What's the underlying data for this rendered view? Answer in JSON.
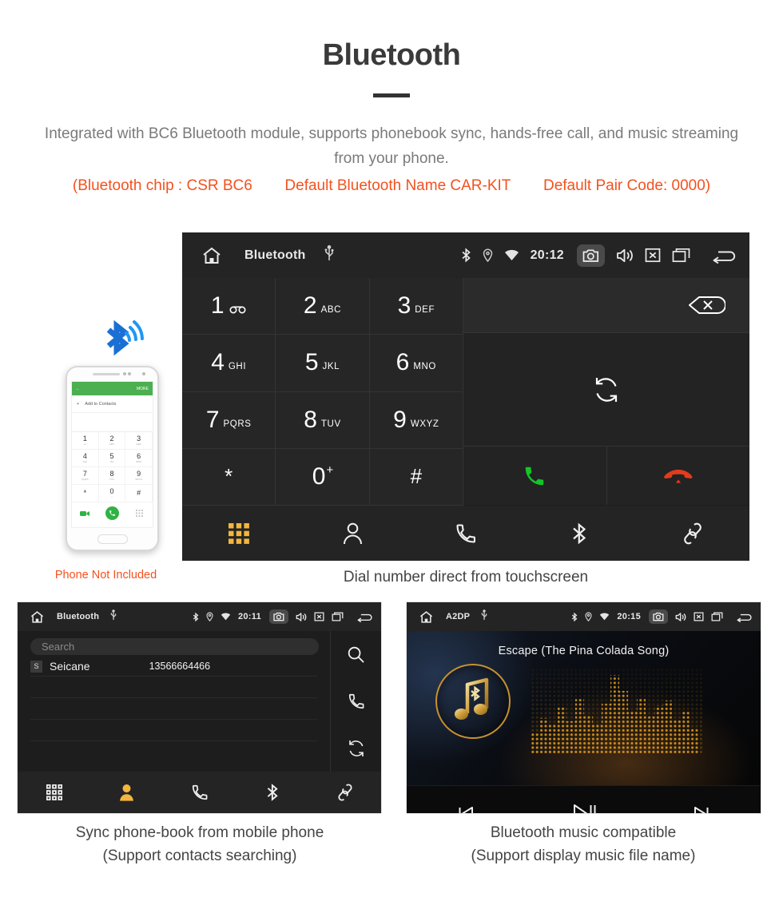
{
  "header": {
    "title": "Bluetooth",
    "intro": "Integrated with BC6 Bluetooth module, supports phonebook sync, hands-free call, and music streaming from your phone.",
    "spec_open": "(Bluetooth chip : CSR BC6",
    "spec_name": "Default Bluetooth Name CAR-KIT",
    "spec_code": "Default Pair Code: 0000)"
  },
  "accent_colors": {
    "orange_text": "#f4511e",
    "tab_active": "#f3b53f",
    "call_green": "#12c528",
    "end_red": "#e23c1d",
    "gold": "#c8912f",
    "phone_green": "#4caf50"
  },
  "main_unit": {
    "statusbar": {
      "home_icon": "home-icon",
      "title": "Bluetooth",
      "usb_icon": "usb-icon",
      "bluetooth_icon": "bluetooth-icon",
      "location_icon": "location-icon",
      "wifi_icon": "wifi-icon",
      "clock": "20:12",
      "camera_icon": "camera-icon",
      "volume_icon": "volume-icon",
      "mute_icon": "mute-box-icon",
      "windows_icon": "recent-apps-icon",
      "back_icon": "back-arrow-icon"
    },
    "keys": [
      {
        "num": "1",
        "sub": "",
        "voicemail": true
      },
      {
        "num": "2",
        "sub": "ABC"
      },
      {
        "num": "3",
        "sub": "DEF"
      },
      {
        "num": "4",
        "sub": "GHI"
      },
      {
        "num": "5",
        "sub": "JKL"
      },
      {
        "num": "6",
        "sub": "MNO"
      },
      {
        "num": "7",
        "sub": "PQRS"
      },
      {
        "num": "8",
        "sub": "TUV"
      },
      {
        "num": "9",
        "sub": "WXYZ"
      },
      {
        "num": "*",
        "sub": "",
        "symbol": true
      },
      {
        "num": "0",
        "sub": "+",
        "plus": true
      },
      {
        "num": "#",
        "sub": "",
        "symbol": true
      }
    ],
    "actions": {
      "delete_icon": "backspace-icon",
      "sync_icon": "sync-icon",
      "call_icon": "call-icon",
      "end_call_icon": "end-call-icon"
    },
    "tabs": [
      {
        "icon": "dialpad-icon",
        "active": true
      },
      {
        "icon": "contacts-icon",
        "active": false
      },
      {
        "icon": "call-log-icon",
        "active": false
      },
      {
        "icon": "bluetooth-icon",
        "active": false
      },
      {
        "icon": "link-icon",
        "active": false
      }
    ],
    "caption": "Dial number direct from touchscreen"
  },
  "phone_mockup": {
    "bluetooth_icon": "bluetooth-signal-icon",
    "screen": {
      "back_icon": "back-arrow-icon",
      "more_label": "MORE",
      "add_contacts_label": "Add to Contacts",
      "keys": [
        {
          "num": "1",
          "sub": "oo"
        },
        {
          "num": "2",
          "sub": "ABC"
        },
        {
          "num": "3",
          "sub": "DEF"
        },
        {
          "num": "4",
          "sub": "GHI"
        },
        {
          "num": "5",
          "sub": "JKL"
        },
        {
          "num": "6",
          "sub": "MNO"
        },
        {
          "num": "7",
          "sub": "PQRS"
        },
        {
          "num": "8",
          "sub": "TUV"
        },
        {
          "num": "9",
          "sub": "WXYZ"
        },
        {
          "num": "*",
          "sub": ""
        },
        {
          "num": "0",
          "sub": "+"
        },
        {
          "num": "#",
          "sub": ""
        }
      ],
      "video_call_icon": "video-call-icon",
      "call_icon": "call-icon",
      "keypad_icon": "keypad-icon"
    },
    "caption": "Phone Not Included"
  },
  "phonebook_unit": {
    "statusbar": {
      "home_icon": "home-icon",
      "title": "Bluetooth",
      "usb_icon": "usb-icon",
      "clock": "20:11",
      "camera_icon": "camera-icon"
    },
    "search_placeholder": "Search",
    "contacts": [
      {
        "badge": "S",
        "name": "Seicane",
        "number": "13566664466"
      }
    ],
    "side_actions": [
      {
        "icon": "search-icon"
      },
      {
        "icon": "call-icon"
      },
      {
        "icon": "sync-icon"
      }
    ],
    "tabs": [
      {
        "icon": "dialpad-icon",
        "active": false
      },
      {
        "icon": "contacts-icon",
        "active": true
      },
      {
        "icon": "call-log-icon",
        "active": false
      },
      {
        "icon": "bluetooth-icon",
        "active": false
      },
      {
        "icon": "link-icon",
        "active": false
      }
    ],
    "caption_line1": "Sync phone-book from mobile phone",
    "caption_line2": "(Support contacts searching)"
  },
  "music_unit": {
    "statusbar": {
      "home_icon": "home-icon",
      "title": "A2DP",
      "usb_icon": "usb-icon",
      "clock": "20:15",
      "camera_icon": "camera-icon"
    },
    "song_title": "Escape (The Pina Colada Song)",
    "album_icon": "music-bluetooth-logo-icon",
    "visualizer": "spectrum-dot-matrix",
    "controls": [
      {
        "icon": "previous-track-icon"
      },
      {
        "icon": "play-pause-icon"
      },
      {
        "icon": "next-track-icon"
      }
    ],
    "caption_line1": "Bluetooth music compatible",
    "caption_line2": "(Support display music file name)"
  }
}
